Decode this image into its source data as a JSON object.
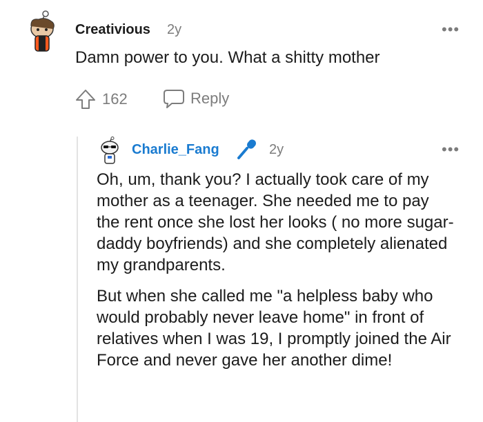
{
  "comment1": {
    "username": "Creativious",
    "age": "2y",
    "body": "Damn power to you. What a shitty mother",
    "upvotes": "162",
    "reply_label": "Reply",
    "more_glyph": "•••"
  },
  "comment2": {
    "username": "Charlie_Fang",
    "age": "2y",
    "badge_icon": "microphone-icon",
    "more_glyph": "•••",
    "paragraphs": [
      "Oh, um, thank you? I actually took care of my mother as a teenager. She needed me to pay the rent once she lost her looks ( no more sugar-daddy boyfriends) and she completely alienated my grandparents.",
      "But when she called me \"a helpless baby who would probably never leave home\" in front of relatives when I was 19, I promptly joined the Air Force and never gave her another dime!"
    ]
  },
  "colors": {
    "op_name": "#1a7bd0",
    "muted": "#7c7c7c",
    "text": "#1c1c1c",
    "thread_line": "#e3e3e3"
  }
}
